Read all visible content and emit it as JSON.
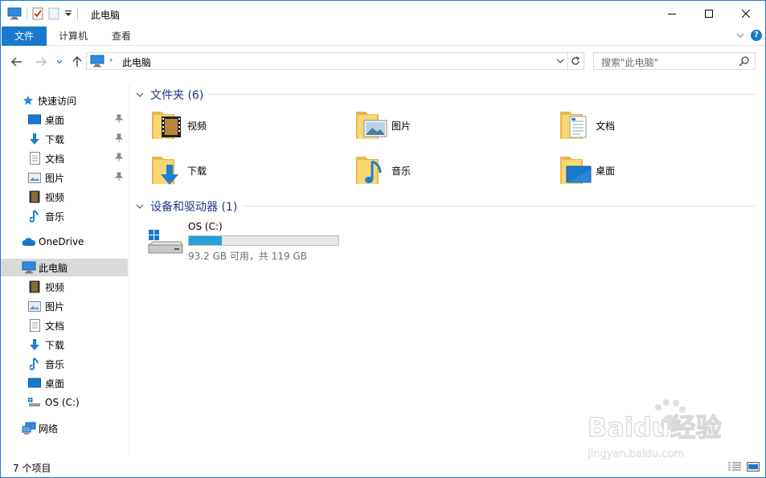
{
  "window": {
    "title": "此电脑"
  },
  "ribbon": {
    "tabs": [
      "文件",
      "计算机",
      "查看"
    ]
  },
  "address": {
    "path": "此电脑",
    "search_placeholder": "搜索\"此电脑\""
  },
  "sidebar": {
    "quick_access": "快速访问",
    "quick_items": [
      "桌面",
      "下载",
      "文档",
      "图片",
      "视频",
      "音乐"
    ],
    "onedrive": "OneDrive",
    "this_pc": "此电脑",
    "pc_items": [
      "视频",
      "图片",
      "文档",
      "下载",
      "音乐",
      "桌面",
      "OS (C:)"
    ],
    "network": "网络"
  },
  "content": {
    "folders_header": "文件夹 (6)",
    "folders": [
      "视频",
      "图片",
      "文档",
      "下载",
      "音乐",
      "桌面"
    ],
    "devices_header": "设备和驱动器 (1)",
    "drive": {
      "name": "OS (C:)",
      "free_text": "93.2 GB 可用，共 119 GB",
      "used_fraction": 0.22
    }
  },
  "status": {
    "count": "7 个项目"
  },
  "watermark": {
    "text": "Baidu经验",
    "url": "jingyan.baidu.com"
  },
  "colors": {
    "accent": "#1979ca",
    "header_text": "#1e3287",
    "selection": "#d9d9d9",
    "drive_bar": "#26a0da"
  }
}
